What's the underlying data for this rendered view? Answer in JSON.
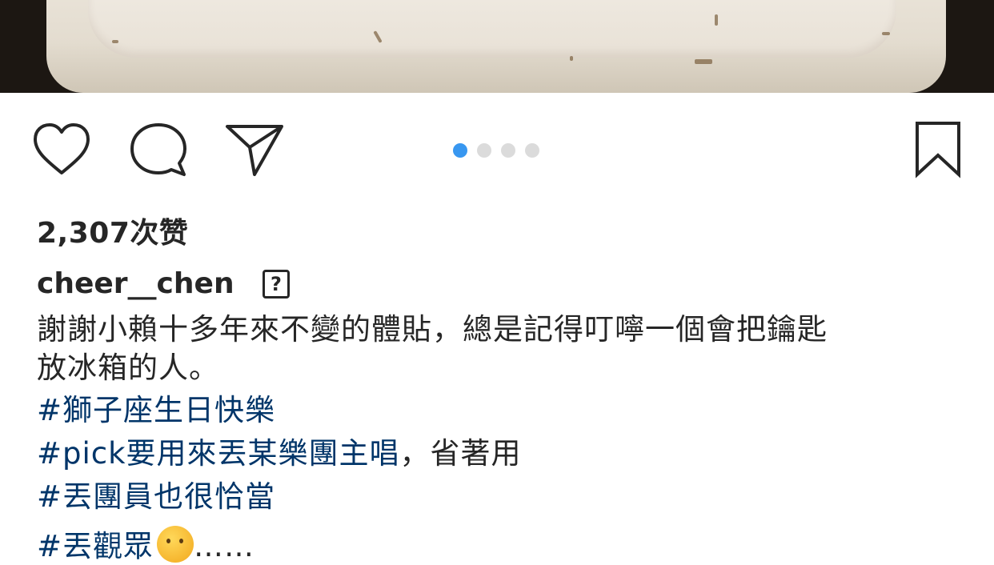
{
  "post": {
    "likes_text": "2,307次赞",
    "username": "cheer__chen",
    "unknown_glyph": "?",
    "caption_lines": [
      "謝謝小賴十多年來不變的體貼，總是記得叮嚀一個會把鑰匙",
      "放冰箱的人。"
    ],
    "hashtag_lines": [
      {
        "tag": "#獅子座生日快樂",
        "rest": ""
      },
      {
        "tag": "#pick要用來丟某樂團主唱",
        "rest": "，省著用"
      },
      {
        "tag": "#丟團員也很恰當",
        "rest": ""
      },
      {
        "tag": "#丟觀眾",
        "rest": "……"
      }
    ],
    "carousel": {
      "count": 4,
      "active_index": 0
    }
  },
  "icons": {
    "like": "heart-icon",
    "comment": "comment-icon",
    "share": "paper-plane-icon",
    "save": "bookmark-icon",
    "emoji": "thinking-face-emoji"
  },
  "colors": {
    "hashtag": "#003569",
    "active_dot": "#3897f0",
    "inactive_dot": "#dbdbdb",
    "text": "#262626"
  }
}
